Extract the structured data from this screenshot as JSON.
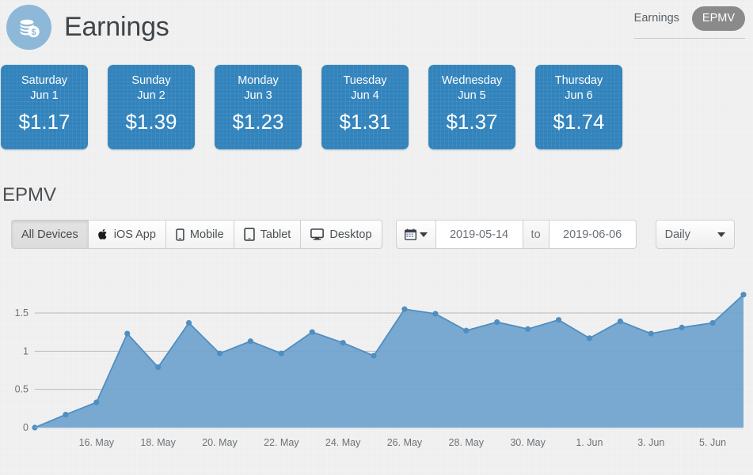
{
  "header": {
    "title": "Earnings",
    "icon": "coins-dollar-icon",
    "nav": [
      {
        "label": "Earnings",
        "active": false
      },
      {
        "label": "EPMV",
        "active": true
      }
    ]
  },
  "day_cards": [
    {
      "dow": "Saturday",
      "date": "Jun 1",
      "amount": "$1.17"
    },
    {
      "dow": "Sunday",
      "date": "Jun 2",
      "amount": "$1.39"
    },
    {
      "dow": "Monday",
      "date": "Jun 3",
      "amount": "$1.23"
    },
    {
      "dow": "Tuesday",
      "date": "Jun 4",
      "amount": "$1.31"
    },
    {
      "dow": "Wednesday",
      "date": "Jun 5",
      "amount": "$1.37"
    },
    {
      "dow": "Thursday",
      "date": "Jun 6",
      "amount": "$1.74"
    }
  ],
  "section": {
    "title": "EPMV"
  },
  "controls": {
    "devices": [
      {
        "label": "All Devices",
        "icon": "none",
        "active": true
      },
      {
        "label": "iOS App",
        "icon": "apple-icon",
        "active": false
      },
      {
        "label": "Mobile",
        "icon": "phone-icon",
        "active": false
      },
      {
        "label": "Tablet",
        "icon": "tablet-icon",
        "active": false
      },
      {
        "label": "Desktop",
        "icon": "monitor-icon",
        "active": false
      }
    ],
    "date_range": {
      "calendar_icon": "calendar-icon",
      "start": "2019-05-14",
      "separator": "to",
      "end": "2019-06-06"
    },
    "interval": {
      "value": "Daily",
      "icon": "caret-down-icon"
    }
  },
  "colors": {
    "card_blue": "#3283bc",
    "series_fill": "#6fa3ce",
    "series_line": "#4f8ec0",
    "accent_circle": "#8db8d8",
    "active_pill": "#8a8a8a",
    "page_bg": "#f2f2f2"
  },
  "chart_data": {
    "type": "area",
    "title": "EPMV",
    "xlabel": "",
    "ylabel": "",
    "ylim": [
      0,
      1.8
    ],
    "grid": true,
    "legend": false,
    "y_ticks": [
      "0",
      "0.5",
      "1",
      "1.5"
    ],
    "y_tick_values": [
      0,
      0.5,
      1,
      1.5
    ],
    "x_tick_labels": [
      "16. May",
      "18. May",
      "20. May",
      "22. May",
      "24. May",
      "26. May",
      "28. May",
      "30. May",
      "1. Jun",
      "3. Jun",
      "5. Jun"
    ],
    "x": [
      "14. May",
      "15. May",
      "16. May",
      "17. May",
      "18. May",
      "19. May",
      "20. May",
      "21. May",
      "22. May",
      "23. May",
      "24. May",
      "25. May",
      "26. May",
      "27. May",
      "28. May",
      "29. May",
      "30. May",
      "31. May",
      "1. Jun",
      "2. Jun",
      "3. Jun",
      "4. Jun",
      "5. Jun",
      "6. Jun"
    ],
    "values": [
      0.0,
      0.17,
      0.33,
      1.23,
      0.79,
      1.37,
      0.97,
      1.13,
      0.97,
      1.25,
      1.11,
      0.94,
      1.55,
      1.49,
      1.27,
      1.38,
      1.29,
      1.41,
      1.17,
      1.39,
      1.23,
      1.31,
      1.37,
      1.74
    ]
  }
}
